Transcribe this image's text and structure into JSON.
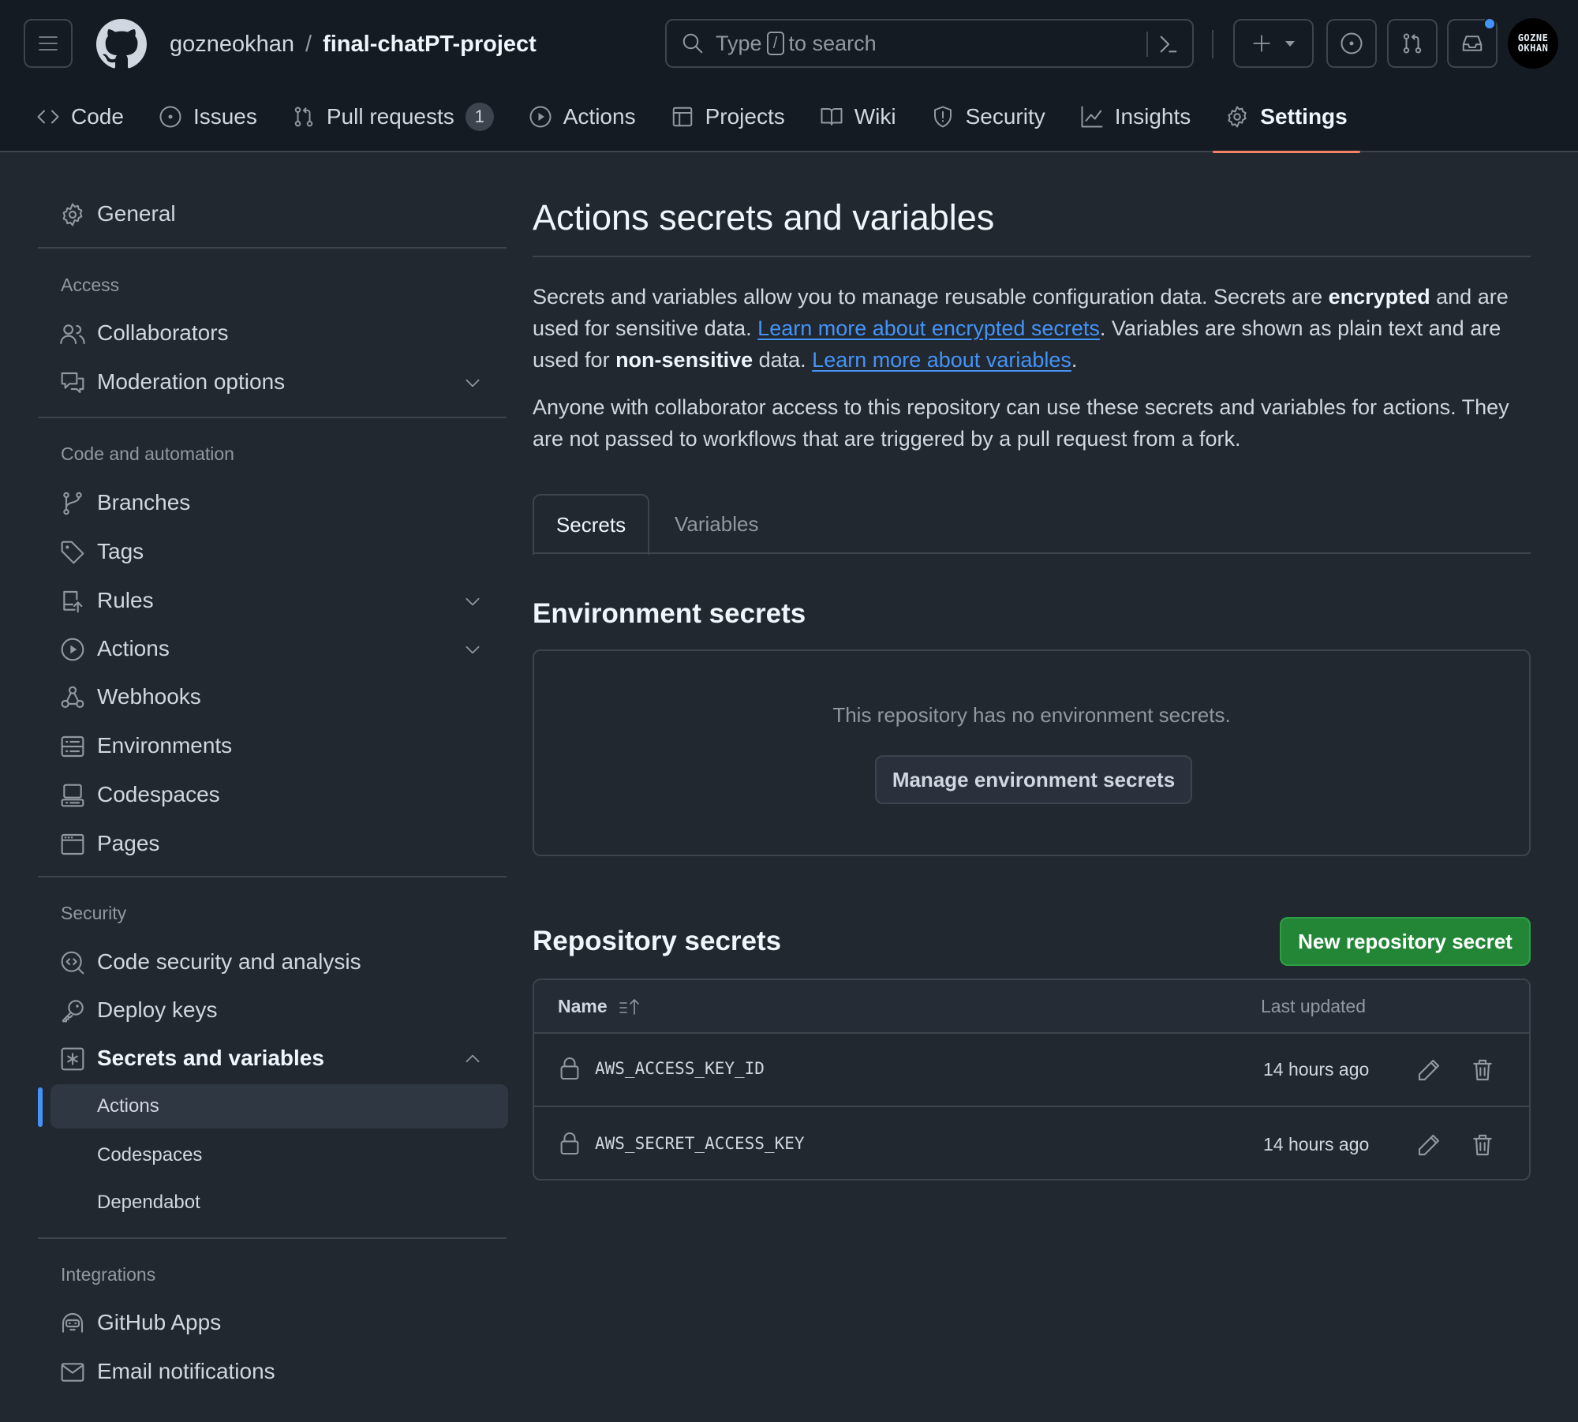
{
  "header": {
    "owner": "gozneokhan",
    "separator": "/",
    "repo": "final-chatPT-project",
    "search_placeholder_pre": "Type",
    "search_key": "/",
    "search_placeholder_post": "to search",
    "avatar_text_line1": "GOZNE",
    "avatar_text_line2": "OKHAN",
    "notification_dot_color": "#4493f8"
  },
  "repo_nav": {
    "tabs": [
      {
        "label": "Code",
        "icon": "code-icon"
      },
      {
        "label": "Issues",
        "icon": "issue-opened-icon"
      },
      {
        "label": "Pull requests",
        "icon": "git-pull-request-icon",
        "count": "1"
      },
      {
        "label": "Actions",
        "icon": "play-icon"
      },
      {
        "label": "Projects",
        "icon": "table-icon"
      },
      {
        "label": "Wiki",
        "icon": "book-icon"
      },
      {
        "label": "Security",
        "icon": "shield-icon"
      },
      {
        "label": "Insights",
        "icon": "graph-icon"
      },
      {
        "label": "Settings",
        "icon": "gear-icon",
        "active": true
      }
    ]
  },
  "sidebar": {
    "general": "General",
    "sections": {
      "access": "Access",
      "code_automation": "Code and automation",
      "security": "Security",
      "integrations": "Integrations"
    },
    "items": {
      "collaborators": "Collaborators",
      "moderation": "Moderation options",
      "branches": "Branches",
      "tags": "Tags",
      "rules": "Rules",
      "actions": "Actions",
      "webhooks": "Webhooks",
      "environments": "Environments",
      "codespaces": "Codespaces",
      "pages": "Pages",
      "code_security": "Code security and analysis",
      "deploy_keys": "Deploy keys",
      "secrets_variables": "Secrets and variables",
      "sub_actions": "Actions",
      "sub_codespaces": "Codespaces",
      "sub_dependabot": "Dependabot",
      "github_apps": "GitHub Apps",
      "email_notifications": "Email notifications"
    }
  },
  "main": {
    "title": "Actions secrets and variables",
    "p1": {
      "t1": "Secrets and variables allow you to manage reusable configuration data. Secrets are ",
      "b1": "encrypted",
      "t2": " and are used for sensitive data. ",
      "link1": "Learn more about encrypted secrets",
      "t3": ". Variables are shown as plain text and are used for ",
      "b2": "non-sensitive",
      "t4": " data. ",
      "link2": "Learn more about variables",
      "t5": "."
    },
    "p2": "Anyone with collaborator access to this repository can use these secrets and variables for actions. They are not passed to workflows that are triggered by a pull request from a fork.",
    "tabs": {
      "secrets": "Secrets",
      "variables": "Variables"
    },
    "env_secrets": {
      "title": "Environment secrets",
      "empty": "This repository has no environment secrets.",
      "button": "Manage environment secrets"
    },
    "repo_secrets": {
      "title": "Repository secrets",
      "new_button": "New repository secret",
      "col_name": "Name",
      "col_updated": "Last updated",
      "rows": [
        {
          "name": "AWS_ACCESS_KEY_ID",
          "updated": "14 hours ago"
        },
        {
          "name": "AWS_SECRET_ACCESS_KEY",
          "updated": "14 hours ago"
        }
      ]
    }
  },
  "colors": {
    "accent_link": "#4493f8",
    "primary_button": "#238636",
    "active_tab_underline": "#f78166"
  }
}
